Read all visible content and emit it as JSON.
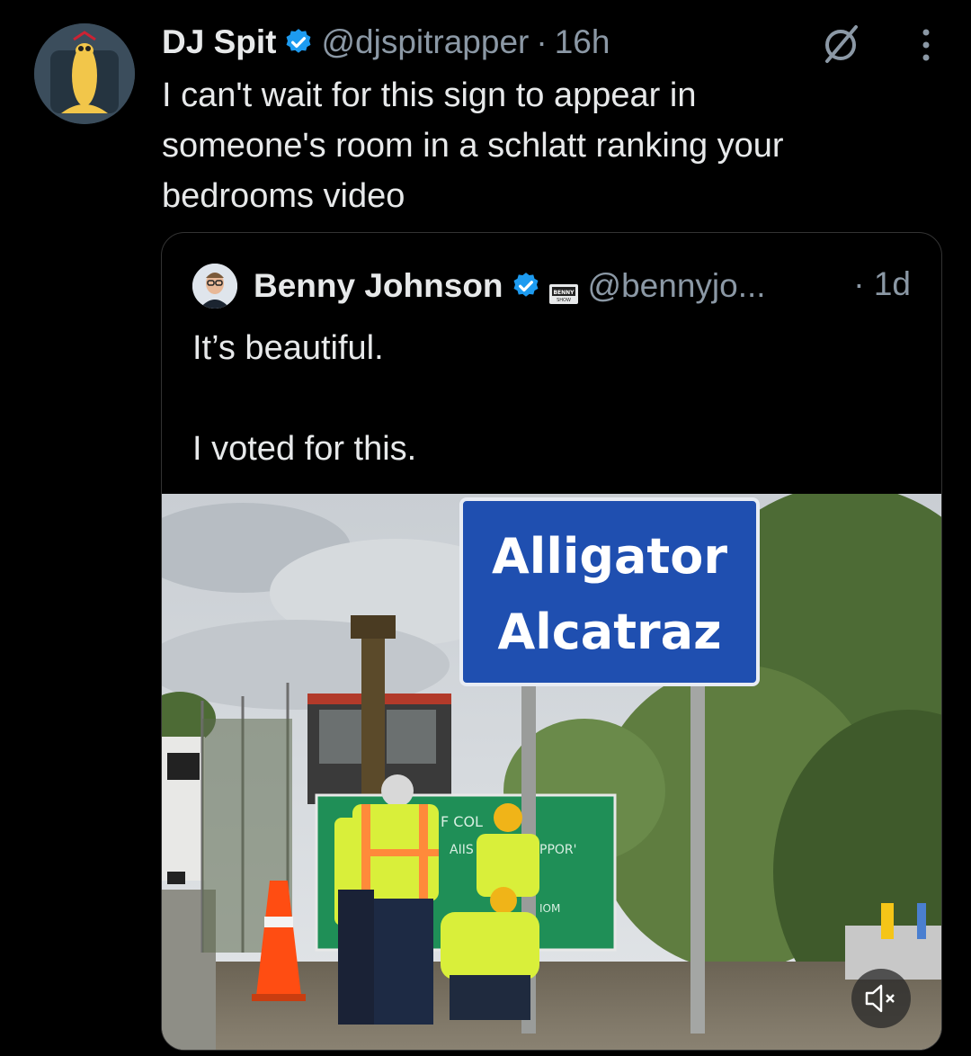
{
  "tweet": {
    "author_name": "DJ Spit",
    "author_handle": "@djspitrapper",
    "separator": "·",
    "time": "16h",
    "text_lines": [
      "I can't wait for this sign to appear in",
      "someone's room in a schlatt ranking your",
      "bedrooms video"
    ]
  },
  "quoted": {
    "author_name": "Benny Johnson",
    "author_handle": "@bennyjo...",
    "affiliate_badge_text": "BENNY SHOW",
    "time": "· 1d",
    "line1": "It’s beautiful.",
    "line2": "I voted for this.",
    "media": {
      "sign_line1": "Alligator",
      "sign_line2": "Alcatraz",
      "green_sign_fragments": [
        "F COL",
        "AIIS",
        "PPOR'",
        "IOM"
      ]
    }
  },
  "icons": {
    "verified": "verified-badge-icon",
    "grok": "grok-icon",
    "more": "more-options-icon",
    "mute": "muted-speaker-icon"
  },
  "colors": {
    "background": "#000000",
    "text": "#e7e9ea",
    "muted": "#8b98a5",
    "verified": "#1d9bf0",
    "sign_blue": "#1f4fb0",
    "sign_green": "#1f8f57"
  }
}
